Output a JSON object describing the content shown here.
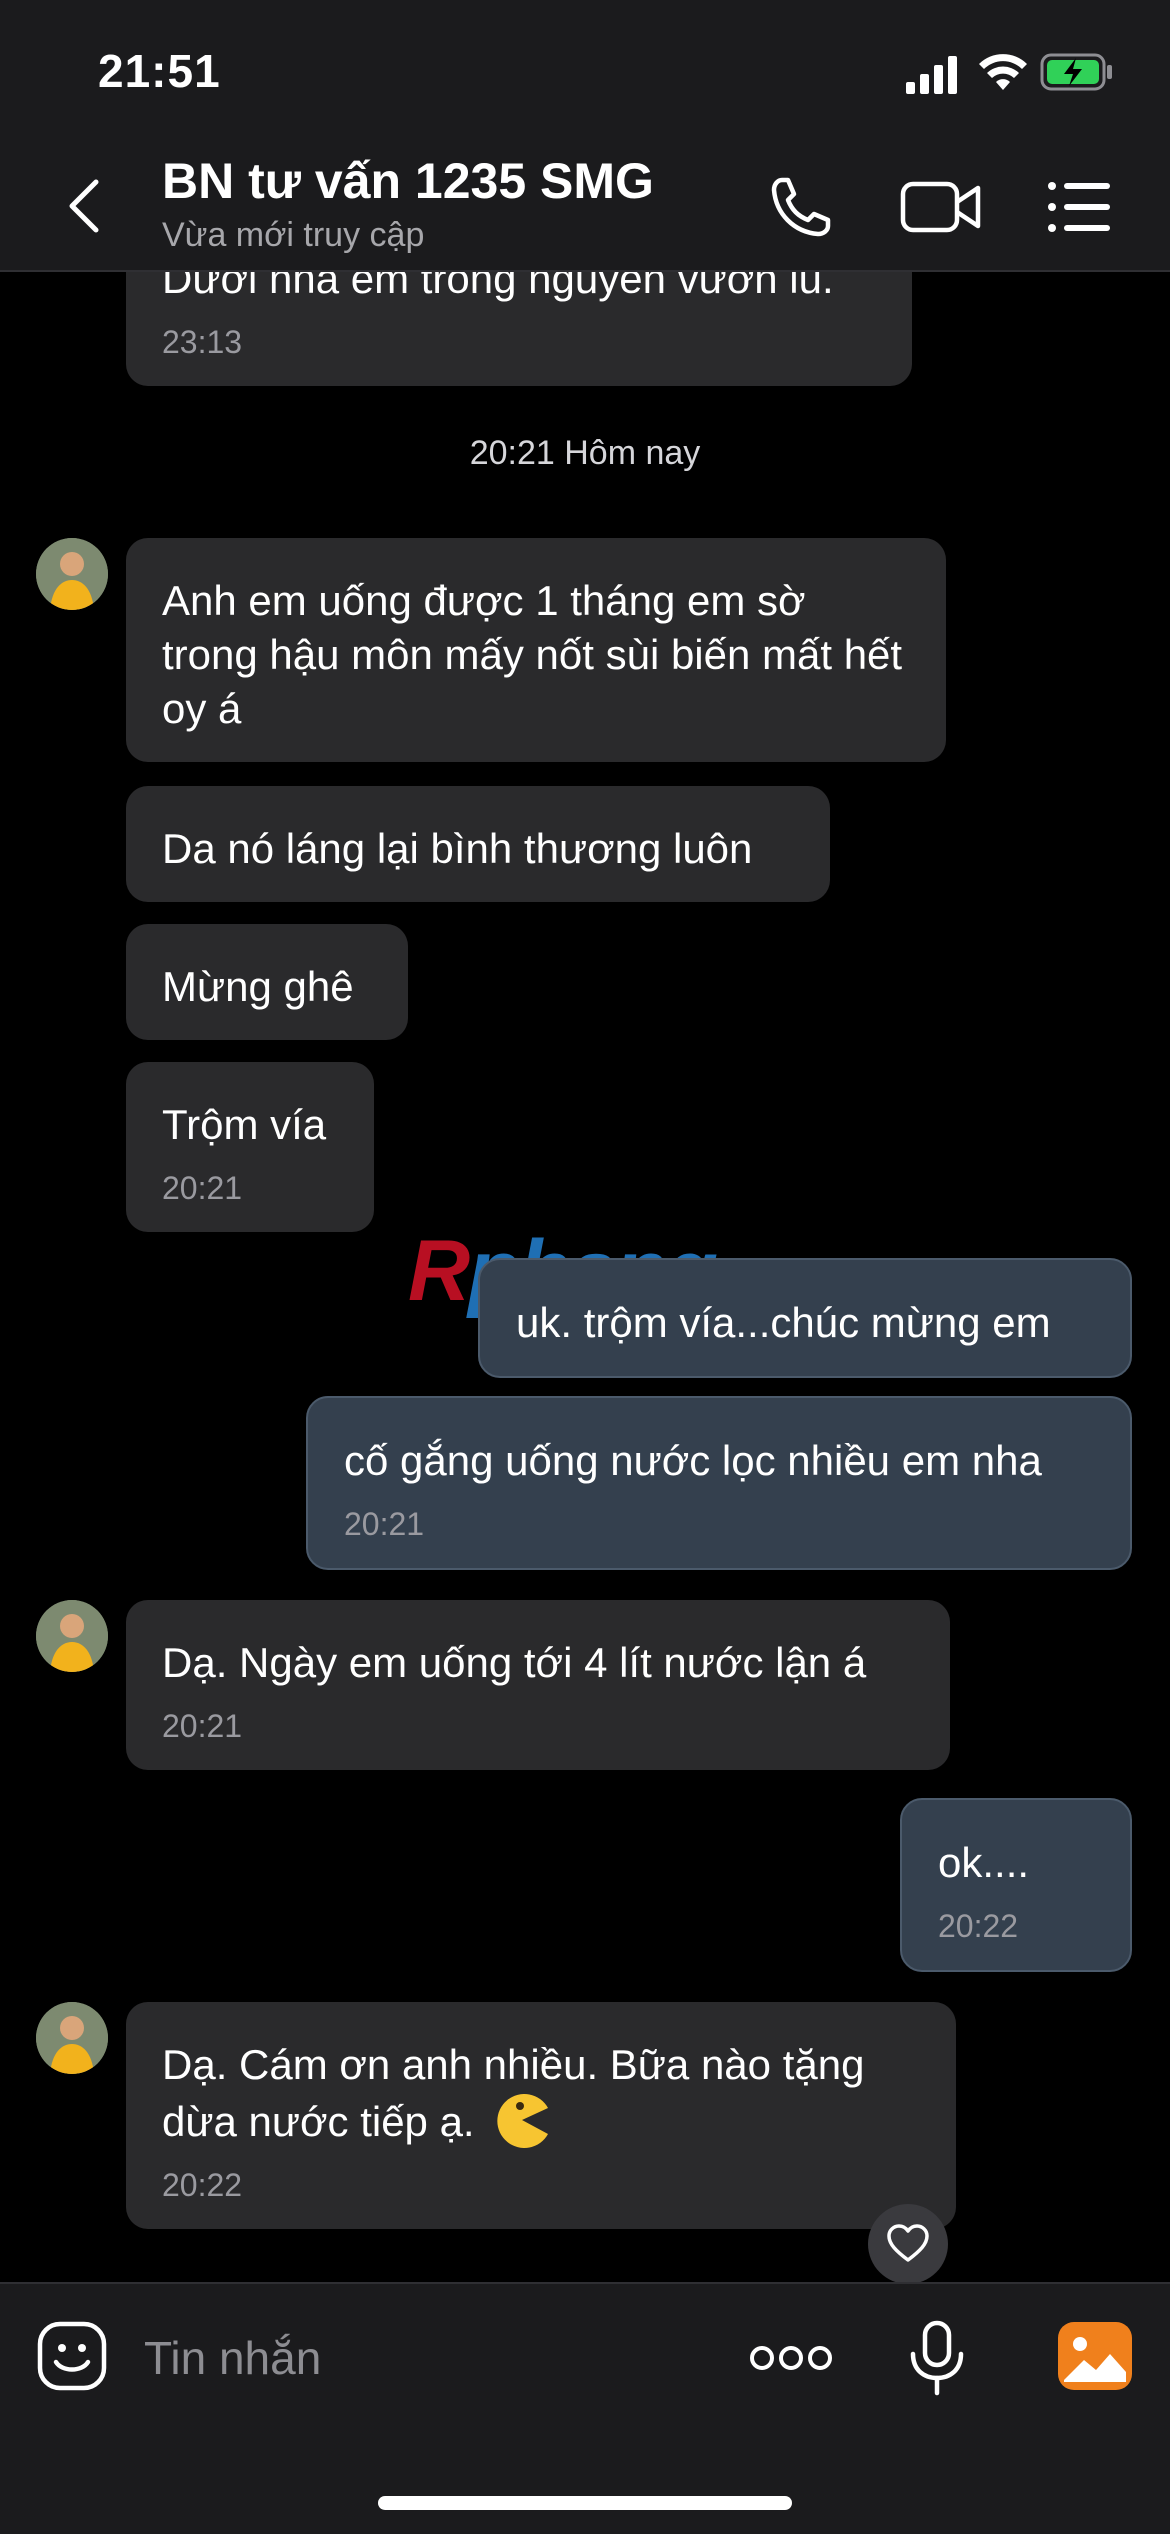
{
  "status_bar": {
    "time": "21:51"
  },
  "header": {
    "title": "BN tư vấn 1235 SMG",
    "subtitle": "Vừa mới truy cập"
  },
  "chat": {
    "prev_message": {
      "text": "Dưới nhà em trồng nguyên vườn lu.",
      "time": "23:13"
    },
    "date_separator": "20:21 Hôm nay",
    "messages": [
      {
        "side": "in",
        "text": "Anh em uống được 1 tháng em sờ trong hậu môn mấy nốt sùi biến mất hết oy á",
        "time": ""
      },
      {
        "side": "in",
        "text": "Da nó láng lại bình thương luôn",
        "time": ""
      },
      {
        "side": "in",
        "text": "Mừng ghê",
        "time": ""
      },
      {
        "side": "in",
        "text": "Trộm vía",
        "time": "20:21"
      },
      {
        "side": "out",
        "text": "uk. trộm vía...chúc mừng em",
        "time": ""
      },
      {
        "side": "out",
        "text": "cố gắng uống nước lọc nhiều em nha",
        "time": "20:21"
      },
      {
        "side": "in",
        "text": "Dạ. Ngày em uống tới 4 lít nước lận á",
        "time": "20:21"
      },
      {
        "side": "out",
        "text": "ok....",
        "time": "20:22"
      },
      {
        "side": "in",
        "text": "Dạ. Cám ơn anh nhiều. Bữa nào tặng dừa nước tiếp ạ.",
        "time": "20:22",
        "emoji": "pacman-emoji"
      }
    ],
    "watermark": {
      "part1": "R",
      "part2": "phang"
    },
    "colors": {
      "incoming": "#2a2a2c",
      "outgoing": "#34404e",
      "background": "#000000"
    }
  },
  "composer": {
    "placeholder": "Tin nhắn",
    "icons": [
      "sticker-icon",
      "more-icon",
      "microphone-icon",
      "gallery-icon"
    ]
  }
}
